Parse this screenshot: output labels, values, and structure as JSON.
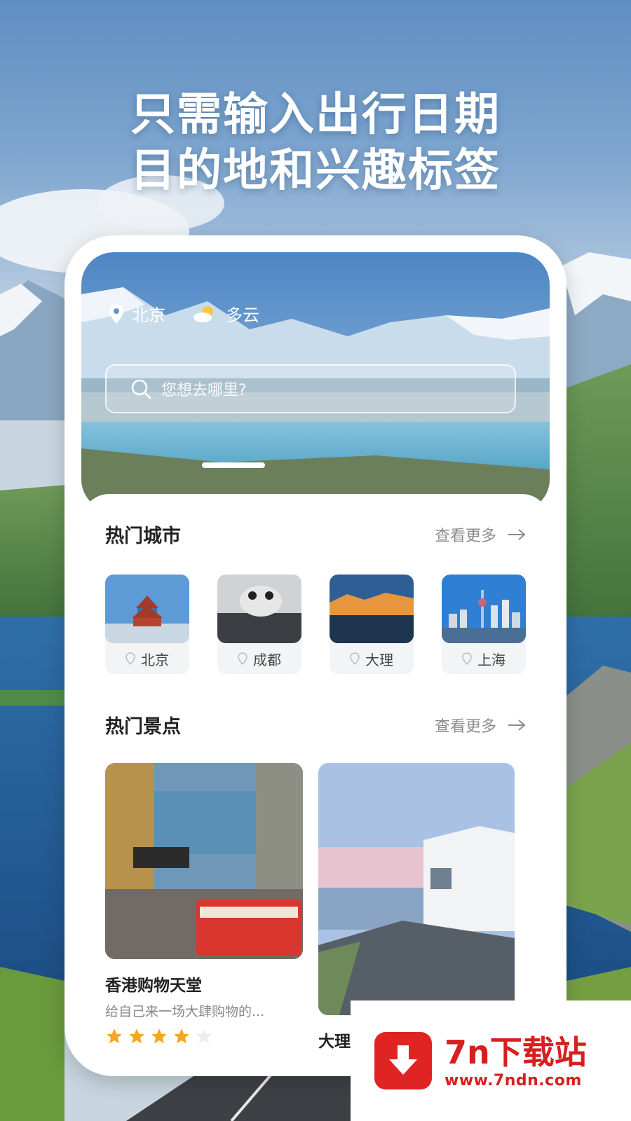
{
  "headline": {
    "line1": "只需输入出行日期",
    "line2": "目的地和兴趣标签"
  },
  "hero": {
    "city": "北京",
    "weather": "多云",
    "search_placeholder": "您想去哪里?",
    "icons": {
      "location": "location-pin-icon",
      "weather": "partly-cloudy-icon",
      "search": "search-icon"
    }
  },
  "hot_cities": {
    "title": "热门城市",
    "more": "查看更多",
    "items": [
      {
        "name": "北京"
      },
      {
        "name": "成都"
      },
      {
        "name": "大理"
      },
      {
        "name": "上海"
      }
    ]
  },
  "hot_spots": {
    "title": "热门景点",
    "more": "查看更多",
    "items": [
      {
        "title": "香港购物天堂",
        "desc": "给自己来一场大肆购物的...",
        "rating": 4,
        "rating_max": 5
      },
      {
        "title": "大理"
      }
    ]
  },
  "watermark": {
    "brand": "7n下载站",
    "url": "www.7ndn.com"
  },
  "colors": {
    "accent_star": "#f5a623",
    "watermark_red": "#d61f1f"
  }
}
